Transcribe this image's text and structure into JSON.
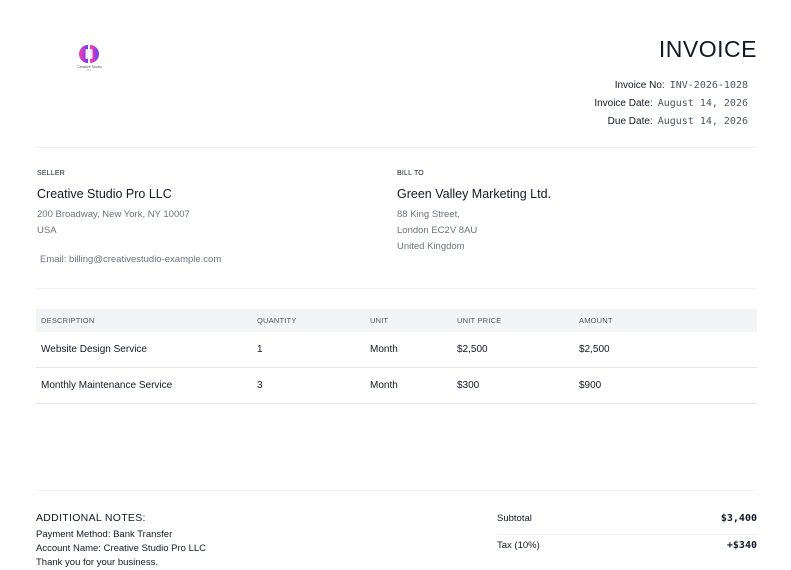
{
  "brand": {
    "name": "Creative Studio",
    "tagline": "Pro",
    "colors": {
      "gradient_start": "#ff3ea5",
      "gradient_end": "#6c3df5"
    }
  },
  "invoice": {
    "title": "INVOICE",
    "meta": [
      {
        "label": "Invoice No:",
        "value": "INV-2026-1028"
      },
      {
        "label": "Invoice Date:",
        "value": "August 14, 2026"
      },
      {
        "label": "Due Date:",
        "value": "August 14, 2026"
      }
    ]
  },
  "seller": {
    "label": "SELLER",
    "name": "Creative Studio Pro LLC",
    "address": [
      "200 Broadway, New York, NY 10007",
      "USA"
    ],
    "email": "Email: billing@creativestudio-example.com"
  },
  "bill_to": {
    "label": "BILL TO",
    "name": "Green Valley Marketing Ltd.",
    "address": [
      "88 King Street,",
      "London EC2V 8AU",
      "United Kingdom"
    ]
  },
  "items": {
    "headers": [
      "DESCRIPTION",
      "QUANTITY",
      "UNIT",
      "UNIT PRICE",
      "AMOUNT"
    ],
    "rows": [
      [
        "Website Design Service",
        "1",
        "Month",
        "$2,500",
        "$2,500"
      ],
      [
        "Monthly Maintenance Service",
        "3",
        "Month",
        "$300",
        "$900"
      ]
    ]
  },
  "notes": {
    "title": "ADDITIONAL NOTES:",
    "lines": [
      "Payment Method: Bank Transfer",
      "Account Name: Creative Studio Pro LLC",
      "Thank you for your business."
    ]
  },
  "totals": [
    {
      "label": "Subtotal",
      "value": "$3,400"
    },
    {
      "label": "Tax (10%)",
      "value": "+$340"
    }
  ]
}
